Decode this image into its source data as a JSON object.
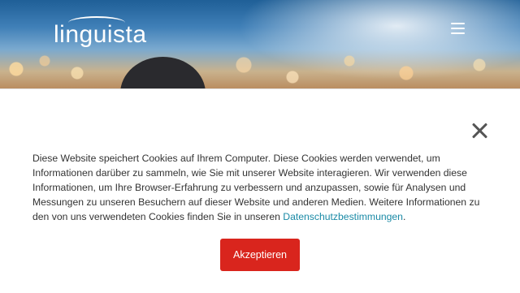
{
  "header": {
    "logo_text": "linguista",
    "menu_icon": "hamburger-menu-icon"
  },
  "cookie_banner": {
    "close_icon": "close-icon",
    "text": "Diese Website speichert Cookies auf Ihrem Computer. Diese Cookies werden verwendet, um Informationen darüber zu sammeln, wie Sie mit unserer Website interagieren. Wir verwenden diese Informationen, um Ihre Browser-Erfahrung zu verbessern und anzupassen, sowie für Analysen und Messungen zu unseren Besuchern auf dieser Website und anderen Medien. Weitere Informationen zu den von uns verwendeten Cookies finden Sie in unseren ",
    "privacy_link": "Datenschutzbestimmungen",
    "text_end": ".",
    "accept_label": "Akzeptieren"
  },
  "colors": {
    "accept_button": "#d9251d",
    "link": "#1a8aa6",
    "text": "#333333"
  }
}
